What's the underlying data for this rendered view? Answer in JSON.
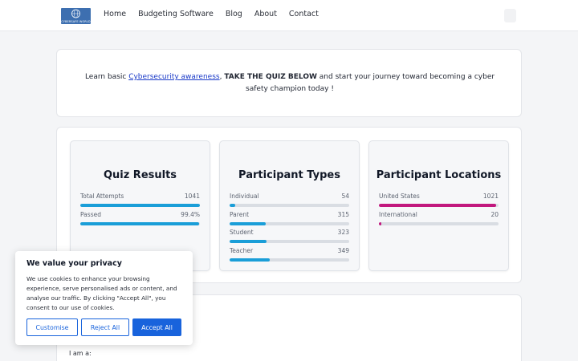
{
  "header": {
    "logo_text": "CYBERSAFE WORLD",
    "nav": [
      "Home",
      "Budgeting Software",
      "Blog",
      "About",
      "Contact"
    ]
  },
  "intro": {
    "prefix": "Learn basic ",
    "link": "Cybersecurity awareness",
    "comma": ", ",
    "bold": "TAKE THE QUIZ BELOW",
    "suffix": " and start your journey toward becoming a cyber safety champion today !"
  },
  "panels": [
    {
      "title": "Quiz Results",
      "stats": [
        {
          "label": "Total Attempts",
          "value": "1041",
          "fraction": 1.0,
          "color": "#1a9ed8"
        },
        {
          "label": "Passed",
          "value": "99.4%",
          "fraction": 0.994,
          "color": "#1a9ed8"
        }
      ]
    },
    {
      "title": "Participant Types",
      "stats": [
        {
          "label": "Individual",
          "value": "54",
          "fraction": 0.05,
          "color": "#1a9ed8"
        },
        {
          "label": "Parent",
          "value": "315",
          "fraction": 0.3,
          "color": "#1a9ed8"
        },
        {
          "label": "Student",
          "value": "323",
          "fraction": 0.31,
          "color": "#1a9ed8"
        },
        {
          "label": "Teacher",
          "value": "349",
          "fraction": 0.335,
          "color": "#1a9ed8"
        }
      ]
    },
    {
      "title": "Participant Locations",
      "stats": [
        {
          "label": "United States",
          "value": "1021",
          "fraction": 0.98,
          "color": "#c2187e"
        },
        {
          "label": "International",
          "value": "20",
          "fraction": 0.02,
          "color": "#c2187e"
        }
      ]
    }
  ],
  "form": {
    "i_am_label": "I am a:"
  },
  "cookie": {
    "title": "We value your privacy",
    "text": "We use cookies to enhance your browsing experience, serve personalised ads or content, and analyse our traffic. By clicking \"Accept All\", you consent to our use of cookies.",
    "customise": "Customise",
    "reject": "Reject All",
    "accept": "Accept All"
  }
}
